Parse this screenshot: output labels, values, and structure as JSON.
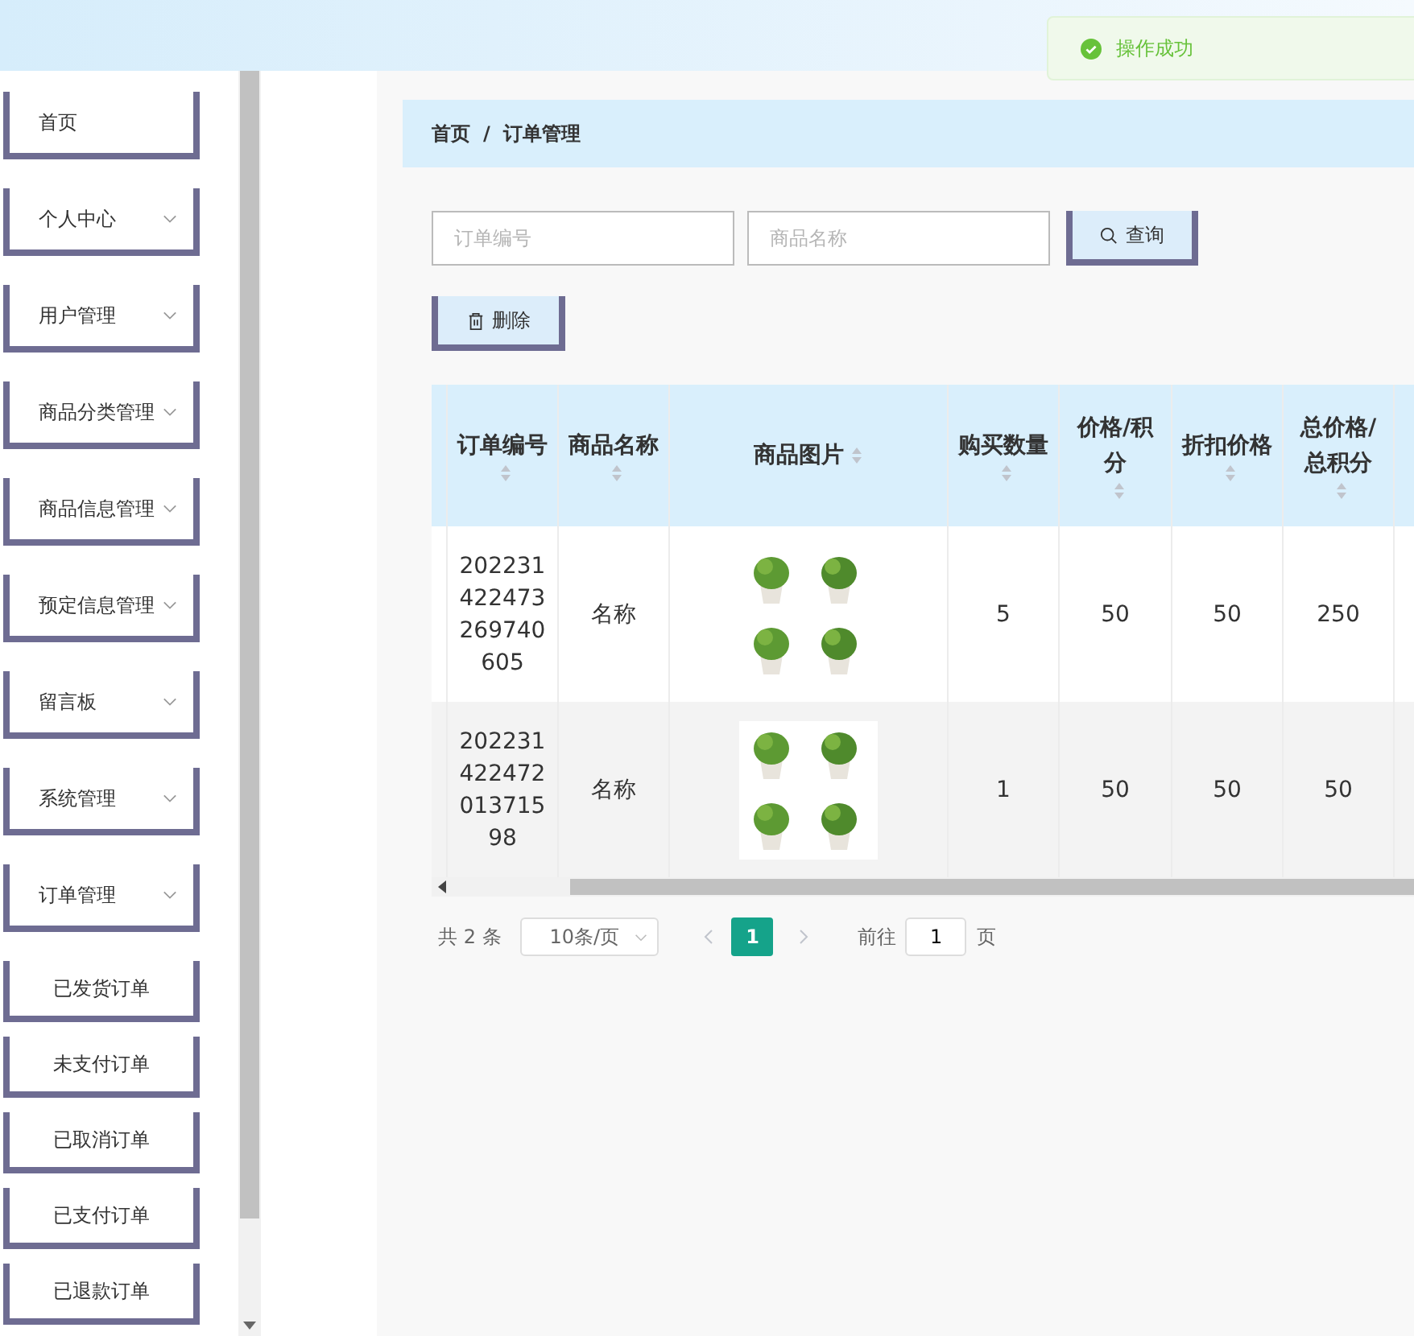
{
  "toast": {
    "text": "操作成功"
  },
  "sidebar": {
    "items": [
      {
        "label": "首页",
        "kind": "link"
      },
      {
        "label": "个人中心",
        "kind": "menu"
      },
      {
        "label": "用户管理",
        "kind": "menu"
      },
      {
        "label": "商品分类管理",
        "kind": "menu"
      },
      {
        "label": "商品信息管理",
        "kind": "menu"
      },
      {
        "label": "预定信息管理",
        "kind": "menu"
      },
      {
        "label": "留言板",
        "kind": "menu"
      },
      {
        "label": "系统管理",
        "kind": "menu"
      },
      {
        "label": "订单管理",
        "kind": "menu"
      },
      {
        "label": "已发货订单",
        "kind": "subitem"
      },
      {
        "label": "未支付订单",
        "kind": "subitem"
      },
      {
        "label": "已取消订单",
        "kind": "subitem"
      },
      {
        "label": "已支付订单",
        "kind": "subitem"
      },
      {
        "label": "已退款订单",
        "kind": "subitem"
      }
    ]
  },
  "breadcrumb": {
    "items": [
      "首页",
      "订单管理"
    ],
    "separator": "/"
  },
  "search": {
    "fields": [
      {
        "placeholder": "订单编号"
      },
      {
        "placeholder": "商品名称"
      }
    ],
    "button": "查询"
  },
  "toolbar": {
    "delete_button": "删除"
  },
  "table": {
    "columns": [
      "订单编号",
      "商品名称",
      "商品图片",
      "购买数量",
      "价格/积分",
      "折扣价格",
      "总价格/总积分"
    ],
    "rows": [
      {
        "order_no": "202231422473269740605",
        "name": "名称",
        "quantity": "5",
        "price": "50",
        "discount": "50",
        "total": "250"
      },
      {
        "order_no": "20223142247201371598",
        "name": "名称",
        "quantity": "1",
        "price": "50",
        "discount": "50",
        "total": "50"
      }
    ]
  },
  "pagination": {
    "total": "共 2 条",
    "page_size": "10条/页",
    "pages": [
      {
        "label": "1",
        "selected": true
      }
    ],
    "goto_label": "前往",
    "goto_value": "1",
    "page_suffix": "页"
  }
}
